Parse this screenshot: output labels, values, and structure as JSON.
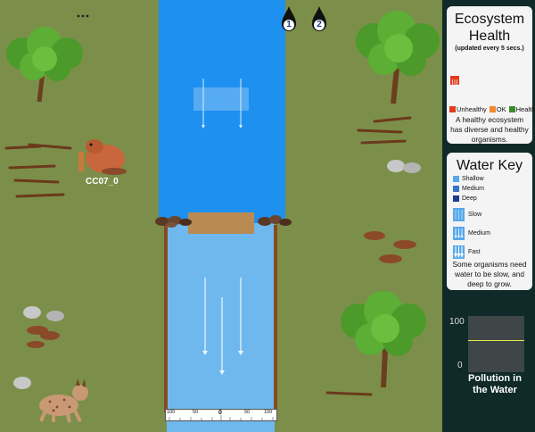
{
  "game": {
    "menu_icon": "ellipsis-icon",
    "beaver_label": "CC07_0",
    "markers": [
      {
        "label": "1"
      },
      {
        "label": "2"
      }
    ],
    "ruler": {
      "labels": [
        "100",
        "50",
        "0",
        "50",
        "100"
      ]
    },
    "colors": {
      "grass": "#7c8f4a",
      "river_upper": "#1e90f0",
      "river_lower": "#6eb8ee",
      "dam": "#b98a52",
      "bank": "#8a4a1e"
    }
  },
  "ecosystem": {
    "title": "Ecosystem Health",
    "subtitle": "(updated every 5 secs.)",
    "legend": [
      {
        "label": "Unhealthy",
        "color": "#e23c1e"
      },
      {
        "label": "OK",
        "color": "#f08a2c"
      },
      {
        "label": "Healthy",
        "color": "#3c8a2a"
      }
    ],
    "description": "A healthy ecosystem has diverse and healthy organisms."
  },
  "water_key": {
    "title": "Water Key",
    "depth": [
      {
        "label": "Shallow",
        "color": "#56a8ec"
      },
      {
        "label": "Medium",
        "color": "#3474c8"
      },
      {
        "label": "Deep",
        "color": "#1a3e8c"
      }
    ],
    "speed": [
      {
        "label": "Slow"
      },
      {
        "label": "Medium"
      },
      {
        "label": "Fast"
      }
    ],
    "description": "Some organisms need water to be slow, and deep to grow."
  },
  "pollution": {
    "title": "Pollution in the Water",
    "axis_max": "100",
    "axis_min": "0",
    "level": 57
  }
}
